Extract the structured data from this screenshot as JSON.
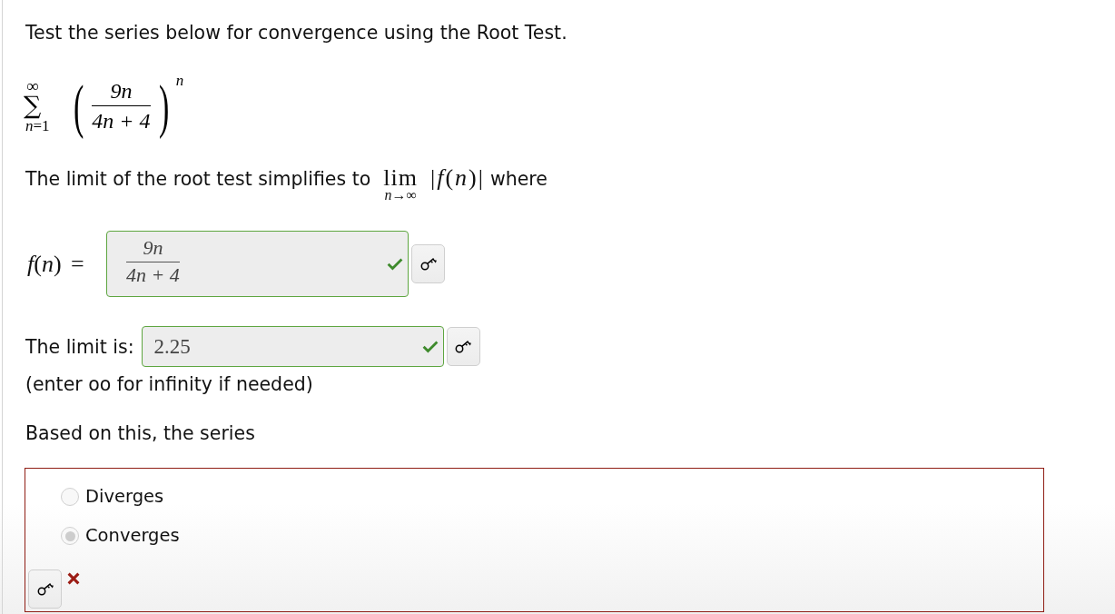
{
  "instructions": "Test the series below for convergence using the Root Test.",
  "series": {
    "upper_limit": "∞",
    "sum_symbol": "∑",
    "lower_limit": "*n*=1",
    "open_paren": "(",
    "numerator": "9n",
    "denominator": "4n + 4",
    "close_paren": ")",
    "exponent": "n"
  },
  "limit_prompt": {
    "before": "The limit of the root test simplifies to",
    "operator": "lim",
    "operator_subscript": "*n*→∞",
    "expression": "|*f*(*n*)|",
    "after": "where"
  },
  "answers": [
    {
      "kind": "fraction",
      "label": "*f*(*n*) =",
      "numerator": "9n",
      "denominator": "4n + 4",
      "correct": true
    },
    {
      "kind": "number",
      "label": "The limit is:",
      "value": "2.25",
      "correct": true,
      "hint": "(enter oo for infinity if needed)"
    }
  ],
  "conclusion": {
    "prompt": "Based on this, the series",
    "options": [
      {
        "label": "Diverges",
        "selected": false
      },
      {
        "label": "Converges",
        "selected": true
      }
    ],
    "correct": false
  }
}
